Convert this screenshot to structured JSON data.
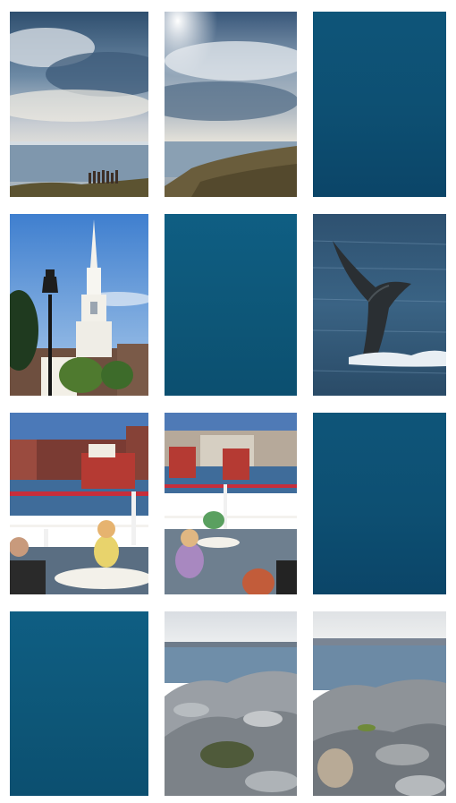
{
  "collage": {
    "columns": 3,
    "rows": 4,
    "tiles": [
      {
        "kind": "photo",
        "subject": "coastal-sky-left",
        "color": "#4a6f8c"
      },
      {
        "kind": "photo",
        "subject": "coastal-sky-right",
        "color": "#56738a"
      },
      {
        "kind": "solid",
        "color": "#0d4f72"
      },
      {
        "kind": "photo",
        "subject": "church-steeple",
        "color": "#5f95d2"
      },
      {
        "kind": "solid",
        "color": "#0e5a7f"
      },
      {
        "kind": "photo",
        "subject": "whale-tail",
        "color": "#30506f"
      },
      {
        "kind": "photo",
        "subject": "harbor-dining-left",
        "color": "#4d78b8"
      },
      {
        "kind": "photo",
        "subject": "harbor-dining-right",
        "color": "#4f7ab6"
      },
      {
        "kind": "solid",
        "color": "#0d4f72"
      },
      {
        "kind": "solid",
        "color": "#0e5a7f"
      },
      {
        "kind": "photo",
        "subject": "rocky-shore-left",
        "color": "#7d8fa3"
      },
      {
        "kind": "photo",
        "subject": "rocky-shore-right",
        "color": "#8295a8"
      }
    ]
  }
}
